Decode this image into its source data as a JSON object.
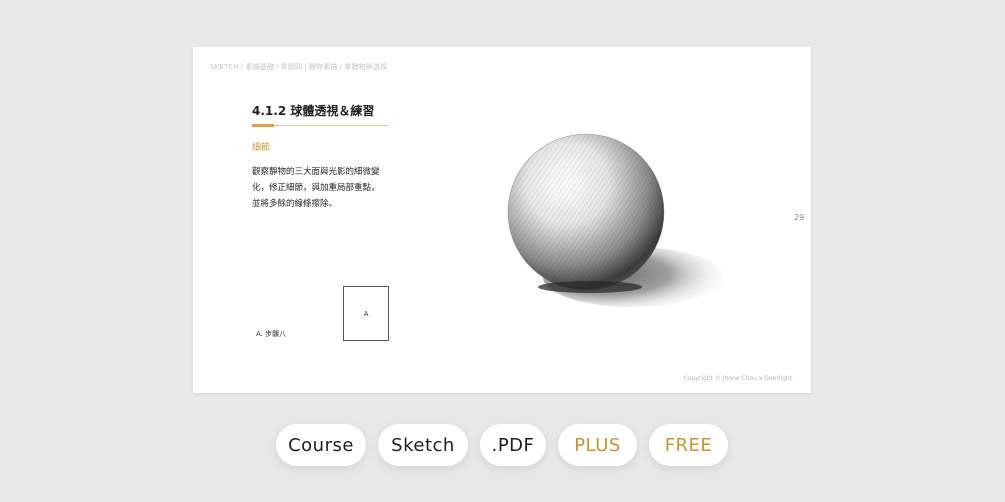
{
  "slide": {
    "breadcrumb": [
      "SKETCH",
      "素描基礎",
      "章節四",
      "靜物素描",
      "單靜物與透視"
    ],
    "breadcrumb_separators": [
      "|",
      "/",
      "|",
      "/"
    ],
    "title": "4.1.2 球體透視＆練習",
    "subheading": "細節",
    "body_lines": [
      "觀察靜物的三大面與光影的細微變",
      "化，修正細節，與加重局部重點，",
      "並將多餘的線條擦除。"
    ],
    "step_label": "A. 步驟八",
    "thumbnail_label": "A",
    "page_number": "29",
    "copyright": "Copyright © Jhone Chou x Deerlight."
  },
  "buttons": [
    {
      "label": "Course",
      "style": "default"
    },
    {
      "label": "Sketch",
      "style": "default"
    },
    {
      "label": ".PDF",
      "style": "default"
    },
    {
      "label": "PLUS",
      "style": "gold"
    },
    {
      "label": "FREE",
      "style": "gold"
    }
  ],
  "colors": {
    "accent": "#d39a2c",
    "background": "#e9e9e9",
    "page": "#ffffff"
  },
  "icons": {
    "sketch": "pencil-sphere-drawing"
  }
}
